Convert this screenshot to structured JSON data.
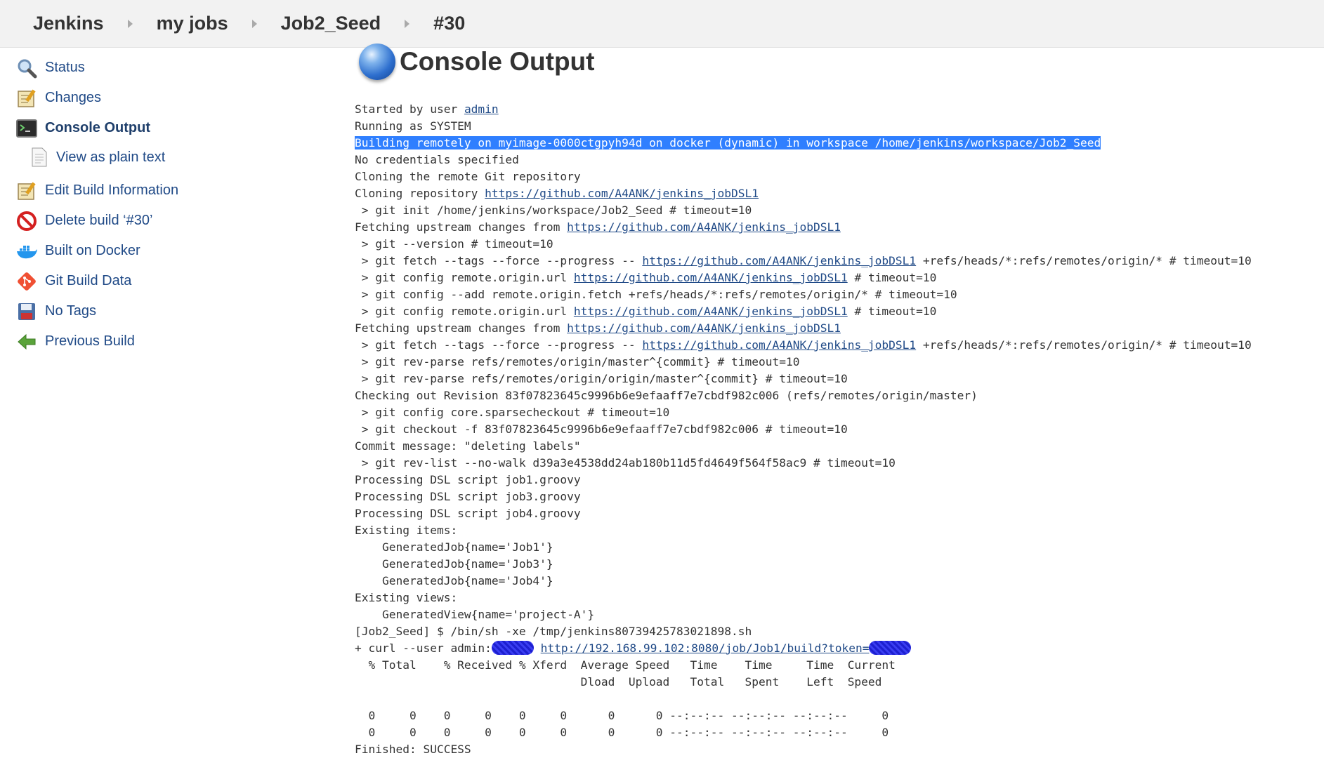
{
  "breadcrumb": {
    "items": [
      "Jenkins",
      "my jobs",
      "Job2_Seed",
      "#30"
    ]
  },
  "sidebar": {
    "items": [
      {
        "label": "Status",
        "icon": "magnifier-icon"
      },
      {
        "label": "Changes",
        "icon": "notepad-icon"
      },
      {
        "label": "Console Output",
        "icon": "terminal-icon"
      },
      {
        "label": "View as plain text",
        "icon": "document-icon"
      },
      {
        "label": "Edit Build Information",
        "icon": "notepad-icon"
      },
      {
        "label": "Delete build ‘#30’",
        "icon": "no-entry-icon"
      },
      {
        "label": "Built on Docker",
        "icon": "docker-whale-icon"
      },
      {
        "label": "Git Build Data",
        "icon": "git-icon"
      },
      {
        "label": "No Tags",
        "icon": "floppy-disk-icon"
      },
      {
        "label": "Previous Build",
        "icon": "arrow-left-icon"
      }
    ]
  },
  "main": {
    "title": "Console Output"
  },
  "console": {
    "started_prefix": "Started by user ",
    "started_user": "admin",
    "running": "Running as SYSTEM",
    "building": "Building remotely on myimage-0000ctgpyh94d on docker (dynamic) in workspace /home/jenkins/workspace/Job2_Seed",
    "no_creds": "No credentials specified",
    "cloning_remote": "Cloning the remote Git repository",
    "cloning_repo_prefix": "Cloning repository ",
    "repo_url": "https://github.com/A4ANK/jenkins_jobDSL1",
    "git_init": " > git init /home/jenkins/workspace/Job2_Seed # timeout=10",
    "fetching_prefix": "Fetching upstream changes from ",
    "git_version": " > git --version # timeout=10",
    "git_fetch_prefix": " > git fetch --tags --force --progress -- ",
    "git_fetch_suffix": " +refs/heads/*:refs/remotes/origin/* # timeout=10",
    "git_config_url_prefix": " > git config remote.origin.url ",
    "git_config_url_suffix": " # timeout=10",
    "git_config_add": " > git config --add remote.origin.fetch +refs/heads/*:refs/remotes/origin/* # timeout=10",
    "rev_parse_1": " > git rev-parse refs/remotes/origin/master^{commit} # timeout=10",
    "rev_parse_2": " > git rev-parse refs/remotes/origin/origin/master^{commit} # timeout=10",
    "checking_out": "Checking out Revision 83f07823645c9996b6e9efaaff7e7cbdf982c006 (refs/remotes/origin/master)",
    "sparse": " > git config core.sparsecheckout # timeout=10",
    "checkout": " > git checkout -f 83f07823645c9996b6e9efaaff7e7cbdf982c006 # timeout=10",
    "commit_msg": "Commit message: \"deleting labels\"",
    "rev_list": " > git rev-list --no-walk d39a3e4538dd24ab180b11d5fd4649f564f58ac9 # timeout=10",
    "dsl1": "Processing DSL script job1.groovy",
    "dsl3": "Processing DSL script job3.groovy",
    "dsl4": "Processing DSL script job4.groovy",
    "existing_items": "Existing items:",
    "gen1": "    GeneratedJob{name='Job1'}",
    "gen3": "    GeneratedJob{name='Job3'}",
    "gen4": "    GeneratedJob{name='Job4'}",
    "existing_views": "Existing views:",
    "genview": "    GeneratedView{name='project-A'}",
    "shell": "[Job2_Seed] $ /bin/sh -xe /tmp/jenkins80739425783021898.sh",
    "curl_prefix": "+ curl --user admin:",
    "curl_url": "http://192.168.99.102:8080/job/Job1/build?token=",
    "curl_hdr1": "  % Total    % Received % Xferd  Average Speed   Time    Time     Time  Current",
    "curl_hdr2": "                                 Dload  Upload   Total   Spent    Left  Speed",
    "curl_blank": " ",
    "curl_row1": "  0     0    0     0    0     0      0      0 --:--:-- --:--:-- --:--:--     0",
    "curl_row2": "  0     0    0     0    0     0      0      0 --:--:-- --:--:-- --:--:--     0",
    "finished": "Finished: SUCCESS"
  },
  "colors": {
    "link": "#204a87",
    "highlight": "#2f7fff",
    "redaction": "#1d1fd0"
  }
}
